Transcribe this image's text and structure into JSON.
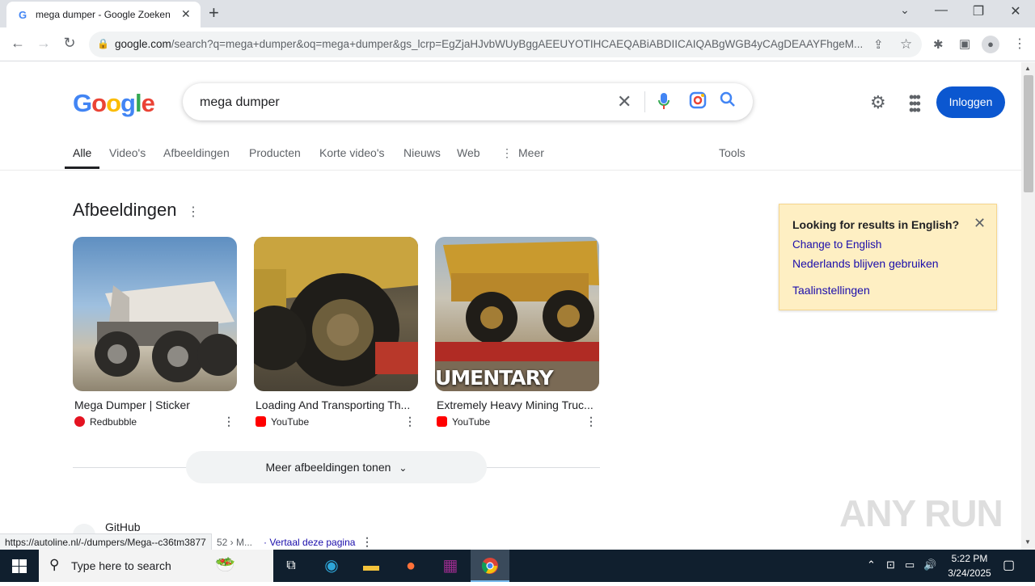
{
  "browser": {
    "tab_title": "mega dumper - Google Zoeken",
    "tab_favicon": "G",
    "url_domain": "google.com",
    "url_rest": "/search?q=mega+dumper&oq=mega+dumper&gs_lcrp=EgZjaHJvbWUyBggAEEUYOTIHCAEQABiABDIICAIQABgWGB4yCAgDEAAYFhgeM...",
    "status_url": "https://autoline.nl/-/dumpers/Mega--c36tm3877"
  },
  "google": {
    "logo": [
      "G",
      "o",
      "o",
      "g",
      "l",
      "e"
    ],
    "logo_colors": [
      "#4285f4",
      "#ea4335",
      "#fbbc05",
      "#4285f4",
      "#34a853",
      "#ea4335"
    ],
    "query": "mega dumper",
    "signin_label": "Inloggen",
    "tabs": [
      {
        "label": "Alle"
      },
      {
        "label": "Video's"
      },
      {
        "label": "Afbeeldingen"
      },
      {
        "label": "Producten"
      },
      {
        "label": "Korte video's"
      },
      {
        "label": "Nieuws"
      },
      {
        "label": "Web"
      },
      {
        "label": "Meer"
      }
    ],
    "tools_label": "Tools"
  },
  "images": {
    "heading": "Afbeeldingen",
    "cards": [
      {
        "caption": "Mega Dumper | Sticker",
        "source": "Redbubble",
        "source_color": "#e41321"
      },
      {
        "caption": "Loading And Transporting Th...",
        "source": "YouTube",
        "source_color": "#ff0000"
      },
      {
        "caption": "Extremely Heavy Mining Truc...",
        "source": "YouTube",
        "source_color": "#ff0000",
        "overlay_text": "UMENTARY"
      }
    ],
    "more_label": "Meer afbeeldingen tonen"
  },
  "language_box": {
    "title": "Looking for results in English?",
    "change_link": "Change to English",
    "keep_link": "Nederlands blijven gebruiken",
    "settings_link": "Taalinstellingen"
  },
  "result": {
    "site_name": "GitHub",
    "crumb": "52 › M...",
    "translate": "· Vertaal deze pagina"
  },
  "watermark": "ANY RUN",
  "taskbar": {
    "search_placeholder": "Type here to search",
    "time": "5:22 PM",
    "date": "3/24/2025"
  }
}
